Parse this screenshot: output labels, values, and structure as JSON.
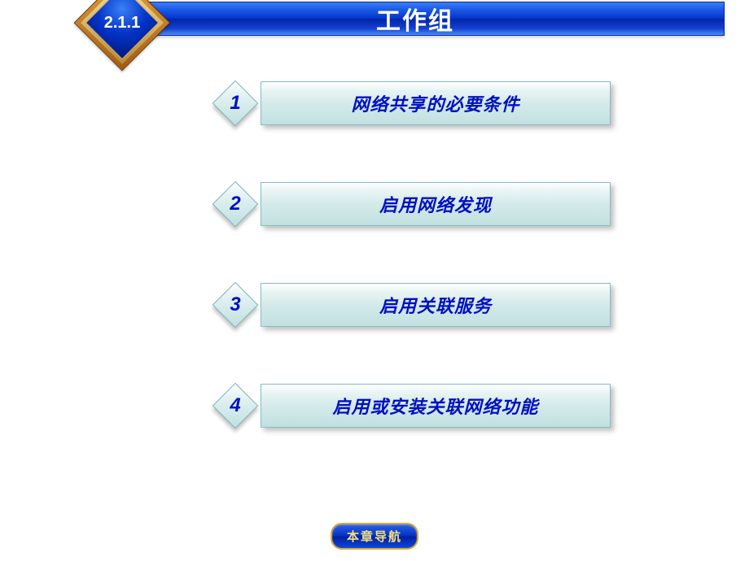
{
  "header": {
    "section_number": "2.1.1",
    "title": "工作组"
  },
  "items": [
    {
      "num": "1",
      "label": "网络共享的必要条件"
    },
    {
      "num": "2",
      "label": "启用网络发现"
    },
    {
      "num": "3",
      "label": "启用关联服务"
    },
    {
      "num": "4",
      "label": "启用或安装关联网络功能"
    }
  ],
  "footer": {
    "nav_label": "本章导航"
  }
}
